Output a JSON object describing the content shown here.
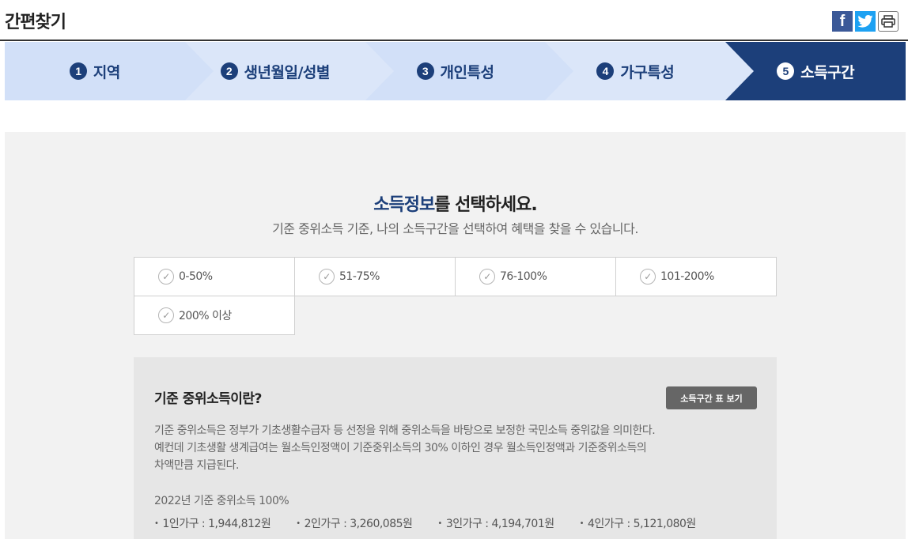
{
  "header": {
    "title": "간편찾기"
  },
  "share": {
    "facebook": "f",
    "icons": [
      "facebook-icon",
      "twitter-icon",
      "print-icon"
    ]
  },
  "steps": [
    {
      "num": "1",
      "label": "지역"
    },
    {
      "num": "2",
      "label": "생년월일/성별"
    },
    {
      "num": "3",
      "label": "개인특성"
    },
    {
      "num": "4",
      "label": "가구특성"
    },
    {
      "num": "5",
      "label": "소득구간",
      "active": true
    }
  ],
  "main": {
    "heading_highlight": "소득정보",
    "heading_rest": "를 선택하세요.",
    "subheading": "기준 중위소득 기준, 나의 소득구간을 선택하여 혜택을 찾을 수 있습니다.",
    "options": [
      "0-50%",
      "51-75%",
      "76-100%",
      "101-200%",
      "200% 이상"
    ]
  },
  "info": {
    "title": "기준 중위소득이란?",
    "button": "소득구간 표 보기",
    "desc_line1": "기준 중위소득은 정부가 기초생활수급자 등 선정을 위해 중위소득을 바탕으로 보정한 국민소득 중위값을 의미한다.",
    "desc_line2": "예컨데 기초생활 생계급여는 월소득인정액이 기준중위소득의 30% 이하인 경우 월소득인정액과 기준중위소득의",
    "desc_line3": "차액만큼 지급된다.",
    "year": "2022년 기준 중위소득 100%",
    "households": [
      "1인가구 : 1,944,812원",
      "2인가구 : 3,260,085원",
      "3인가구 : 4,194,701원",
      "4인가구 : 5,121,080원"
    ]
  },
  "colors": {
    "accent": "#1c3f7a",
    "step_light": "#d2e0f8",
    "panel": "#f2f2f2"
  }
}
